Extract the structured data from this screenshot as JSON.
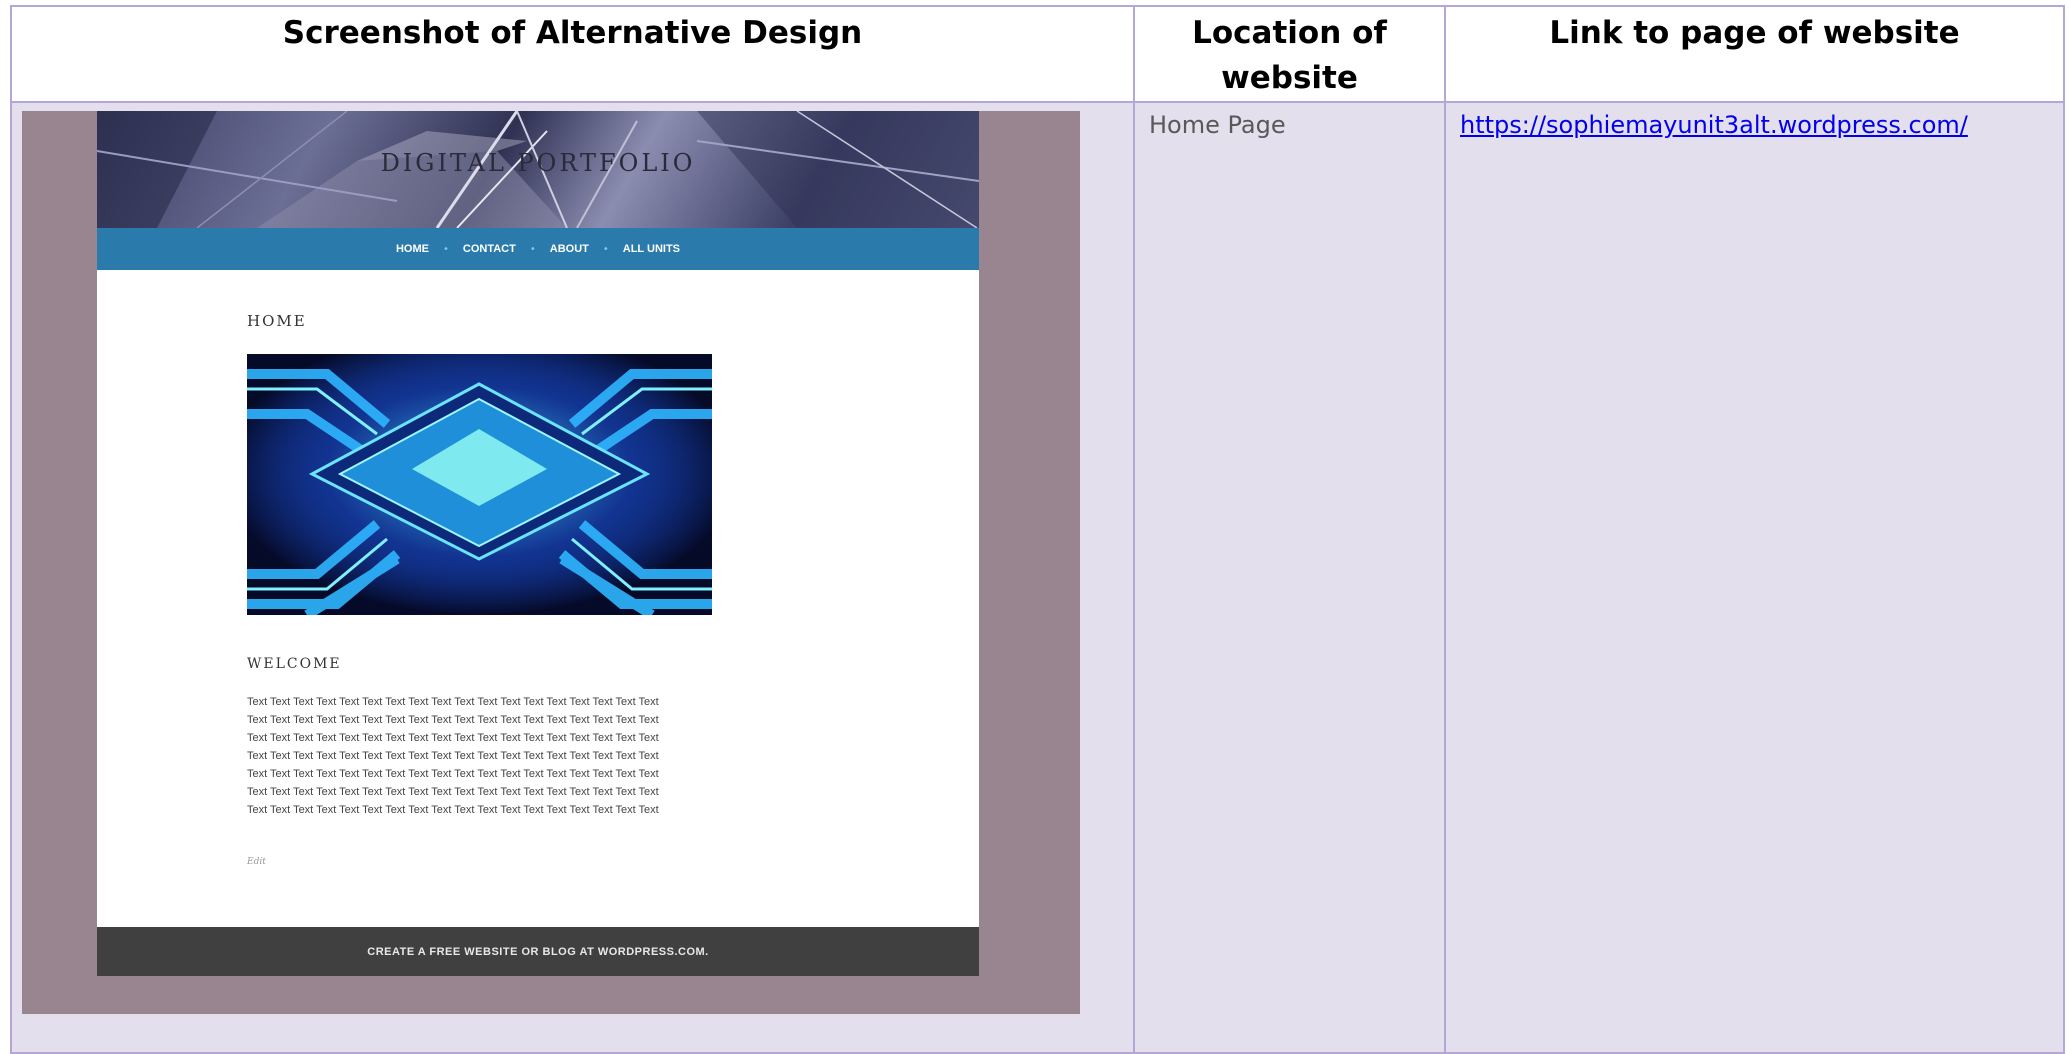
{
  "table": {
    "headers": {
      "screenshot": "Screenshot of Alternative Design",
      "location": "Location of website",
      "link": "Link to page of website"
    },
    "rows": [
      {
        "location": "Home Page",
        "link": "https://sophiemayunit3alt.wordpress.com/"
      }
    ]
  },
  "embedded_site": {
    "title": "DIGITAL PORTFOLIO",
    "nav": [
      "HOME",
      "CONTACT",
      "ABOUT",
      "ALL UNITS"
    ],
    "page_heading": "HOME",
    "welcome_heading": "WELCOME",
    "body_lines": [
      "Text Text Text Text Text Text Text Text Text Text Text Text Text Text Text Text Text Text",
      " Text Text Text Text Text Text Text Text Text Text Text Text Text Text Text Text Text Text",
      " Text Text Text Text Text Text Text Text Text Text Text Text Text Text Text Text Text Text",
      " Text Text Text Text Text Text Text Text Text Text Text Text Text Text Text Text Text Text",
      " Text Text Text Text Text Text Text Text Text Text Text Text Text Text Text Text Text Text",
      " Text Text Text Text Text Text Text Text Text Text Text Text Text Text Text Text Text Text",
      " Text Text Text Text Text Text Text Text Text Text Text Text Text Text Text Text Text Text"
    ],
    "edit_label": "Edit",
    "footer": "CREATE A FREE WEBSITE OR BLOG AT WORDPRESS.COM.",
    "hero_image_icon": "microchip-image"
  },
  "colors": {
    "table_border": "#b4a7d6",
    "cell_background": "#e4dfec",
    "frame_background": "#98858f",
    "nav_background": "#2a7bab",
    "footer_background": "#404040",
    "link": "#0000ee"
  }
}
